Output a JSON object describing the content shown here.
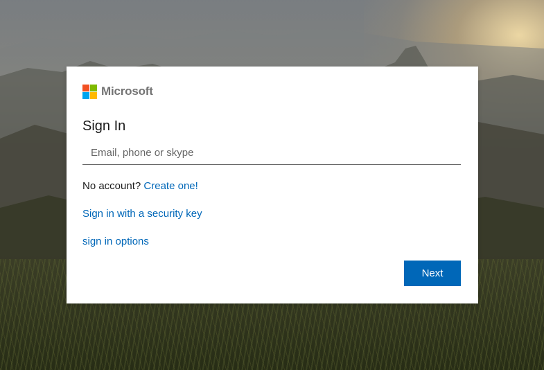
{
  "brand": {
    "name": "Microsoft",
    "logo_colors": [
      "#f25022",
      "#7fba00",
      "#00a4ef",
      "#ffb900"
    ],
    "accent": "#0067b8"
  },
  "signin": {
    "title": "Sign In",
    "email_placeholder": "Email, phone or skype",
    "email_value": "",
    "no_account_text": "No account?",
    "create_link": "Create one!",
    "security_key_link": "Sign in with a security key",
    "options_link": "sign in options",
    "next_label": "Next"
  },
  "background": {
    "description_icon": "landscape-photo"
  }
}
